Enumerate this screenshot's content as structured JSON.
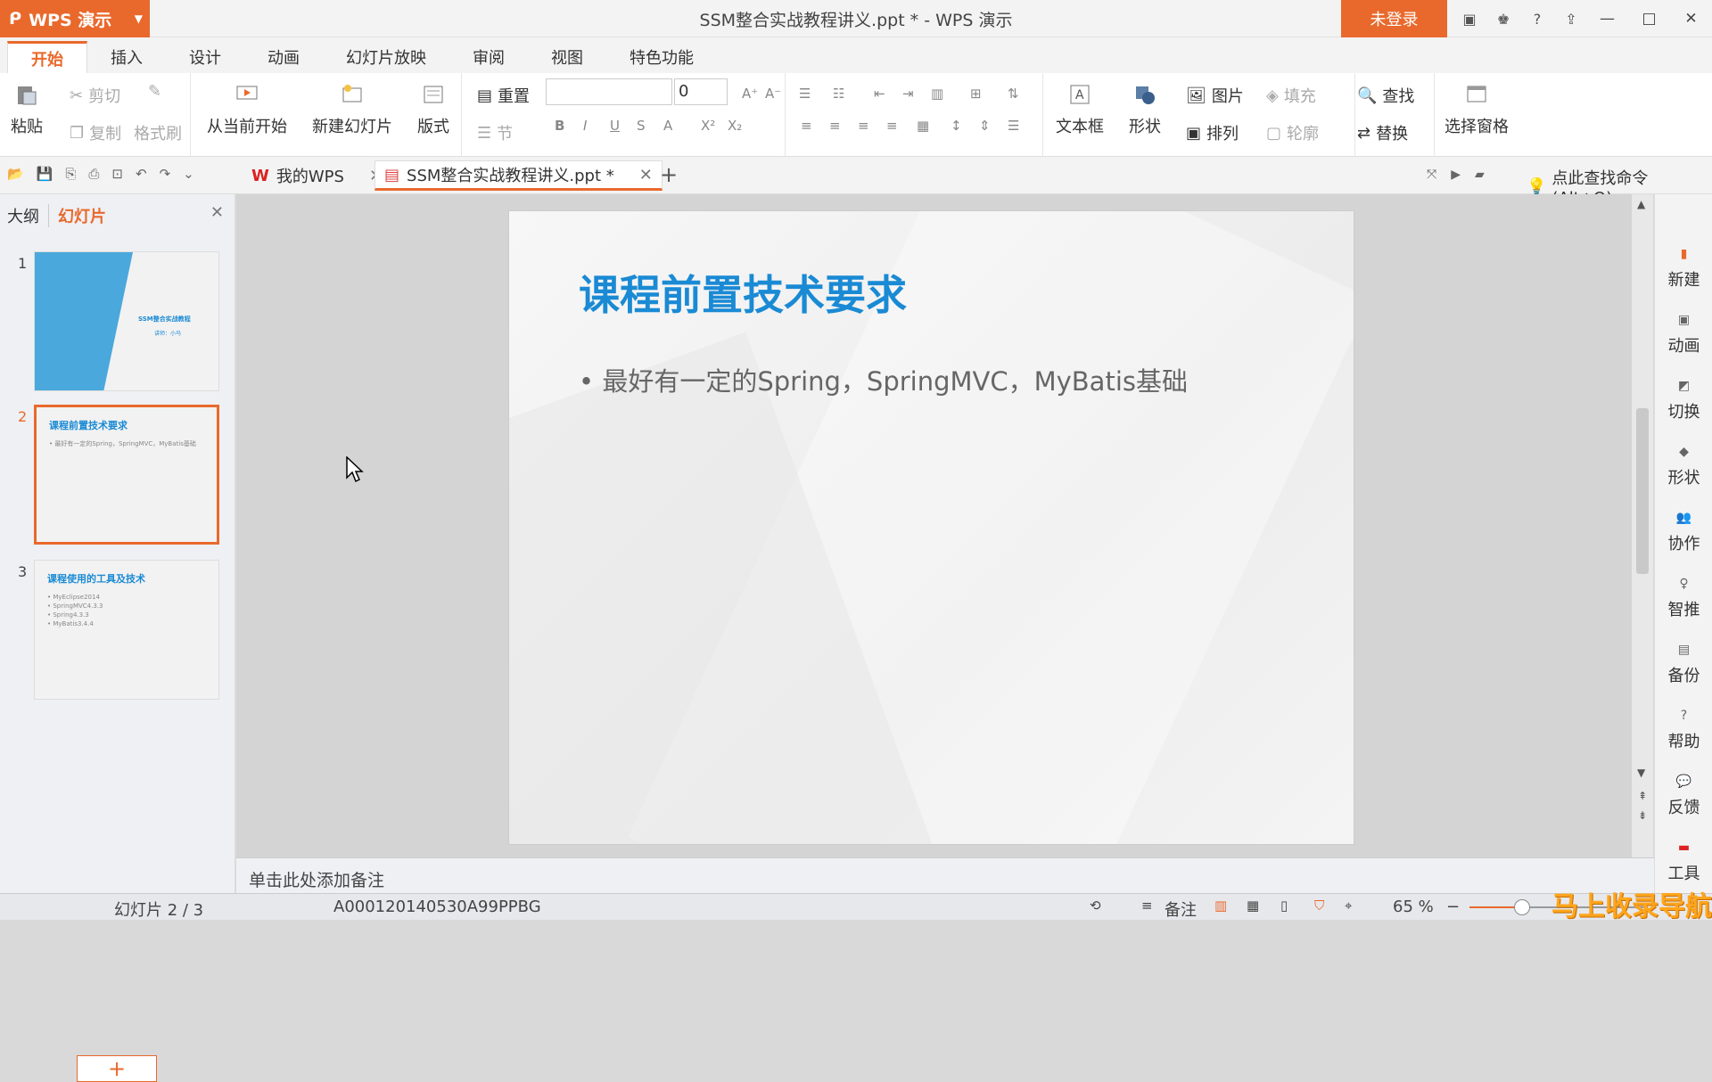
{
  "app": {
    "brand": "WPS 演示",
    "window_title": "SSM整合实战教程讲义.ppt * - WPS 演示",
    "login_label": "未登录"
  },
  "ribbon_tabs": [
    "开始",
    "插入",
    "设计",
    "动画",
    "幻灯片放映",
    "审阅",
    "视图",
    "特色功能"
  ],
  "ribbon": {
    "paste": "粘贴",
    "cut": "剪切",
    "copy": "复制",
    "format_painter": "格式刷",
    "from_current": "从当前开始",
    "new_slide": "新建幻灯片",
    "layout": "版式",
    "reset": "重置",
    "section": "节",
    "font_size": "0",
    "textbox": "文本框",
    "shape": "形状",
    "picture": "图片",
    "fill": "填充",
    "arrange": "排列",
    "outline": "轮廓",
    "find": "查找",
    "replace": "替换",
    "select_pane": "选择窗格"
  },
  "doc_tabs": {
    "my_wps": "我的WPS",
    "current": "SSM整合实战教程讲义.ppt *"
  },
  "find_command": "点此查找命令 (Alt+Q)",
  "left_panel": {
    "outline_tab": "大纲",
    "slides_tab": "幻灯片",
    "thumbnails": [
      {
        "num": "1",
        "title": "SSM整合实战教程",
        "sub": "讲师：小马"
      },
      {
        "num": "2",
        "title": "课程前置技术要求",
        "sub": "• 最好有一定的Spring，SpringMVC，MyBatis基础"
      },
      {
        "num": "3",
        "title": "课程使用的工具及技术",
        "sub": "• MyEclipse2014\n• SpringMVC4.3.3\n• Spring4.3.3\n• MyBatis3.4.4"
      }
    ]
  },
  "slide": {
    "title": "课程前置技术要求",
    "bullet": "• 最好有一定的Spring，SpringMVC，MyBatis基础"
  },
  "right_sidebar": [
    "新建",
    "动画",
    "切换",
    "形状",
    "协作",
    "智推",
    "备份",
    "帮助",
    "反馈",
    "工具"
  ],
  "notes_placeholder": "单击此处添加备注",
  "status": {
    "slide_counter": "幻灯片 2 / 3",
    "template_id": "A000120140530A99PPBG",
    "notes_label": "备注",
    "zoom": "65 %"
  },
  "watermark": "马上收录导航",
  "colors": {
    "accent": "#e9692c",
    "title_blue": "#1a8ad4"
  }
}
